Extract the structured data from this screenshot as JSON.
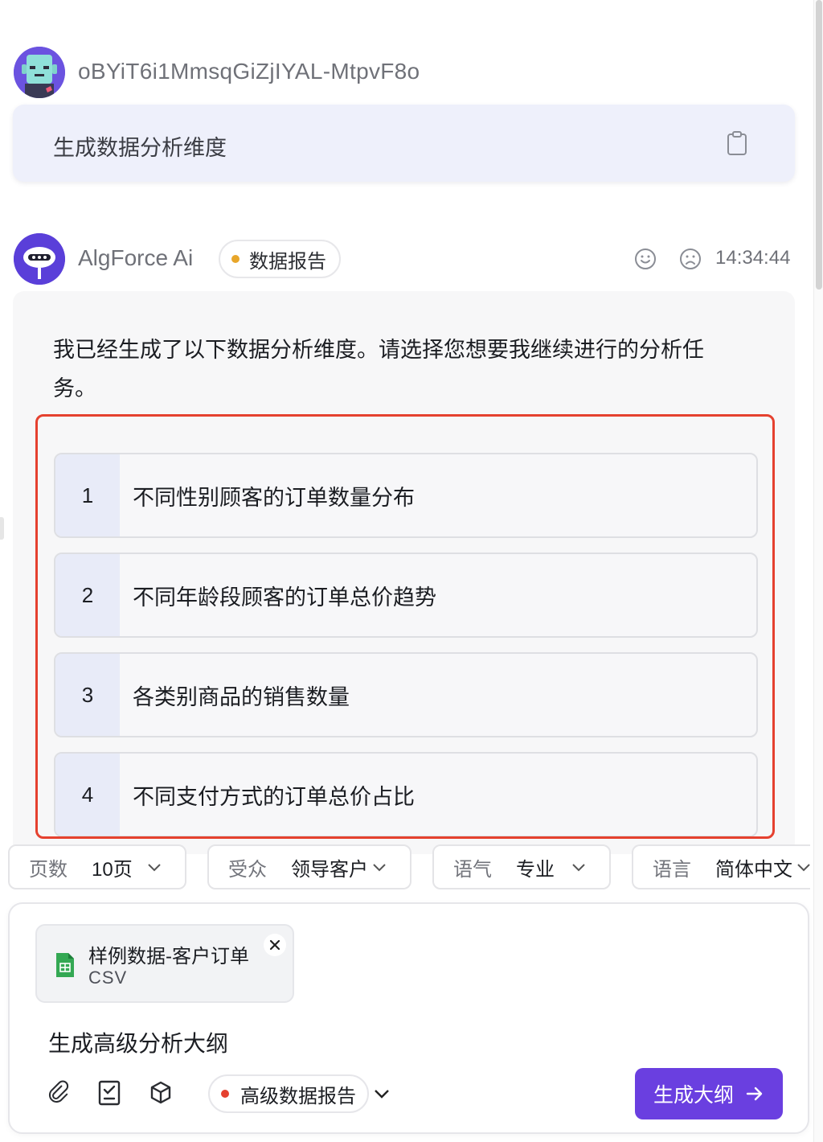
{
  "user_message": {
    "username": "oBYiT6i1MmsqGiZjIYAL-MtpvF8o",
    "text": "生成数据分析维度"
  },
  "ai_message": {
    "name": "AlgForce Ai",
    "badge": "数据报告",
    "timestamp": "14:34:44",
    "text": "我已经生成了以下数据分析维度。请选择您想要我继续进行的分析任务。",
    "tasks": [
      {
        "num": "1",
        "label": "不同性别顾客的订单数量分布"
      },
      {
        "num": "2",
        "label": "不同年龄段顾客的订单总价趋势"
      },
      {
        "num": "3",
        "label": "各类别商品的销售数量"
      },
      {
        "num": "4",
        "label": "不同支付方式的订单总价占比"
      }
    ]
  },
  "options": {
    "pages": {
      "label": "页数",
      "value": "10页"
    },
    "audience": {
      "label": "受众",
      "value": "领导客户"
    },
    "tone": {
      "label": "语气",
      "value": "专业"
    },
    "language": {
      "label": "语言",
      "value": "简体中文"
    }
  },
  "composer": {
    "file": {
      "name": "样例数据-客户订单",
      "type": "CSV"
    },
    "prompt": "生成高级分析大纲",
    "mode": "高级数据报告",
    "submit_label": "生成大纲"
  },
  "colors": {
    "accent": "#6a3fe0",
    "highlight_border": "#e5412f",
    "badge_dot": "#e8a62a",
    "mode_dot": "#e5412f",
    "user_bubble": "#eef0fb"
  },
  "icons": [
    "copy-icon",
    "smile-icon",
    "sad-icon",
    "chevron-down-icon",
    "spreadsheet-file-icon",
    "close-icon",
    "paperclip-icon",
    "checklist-icon",
    "cube-icon",
    "arrow-right-icon"
  ]
}
